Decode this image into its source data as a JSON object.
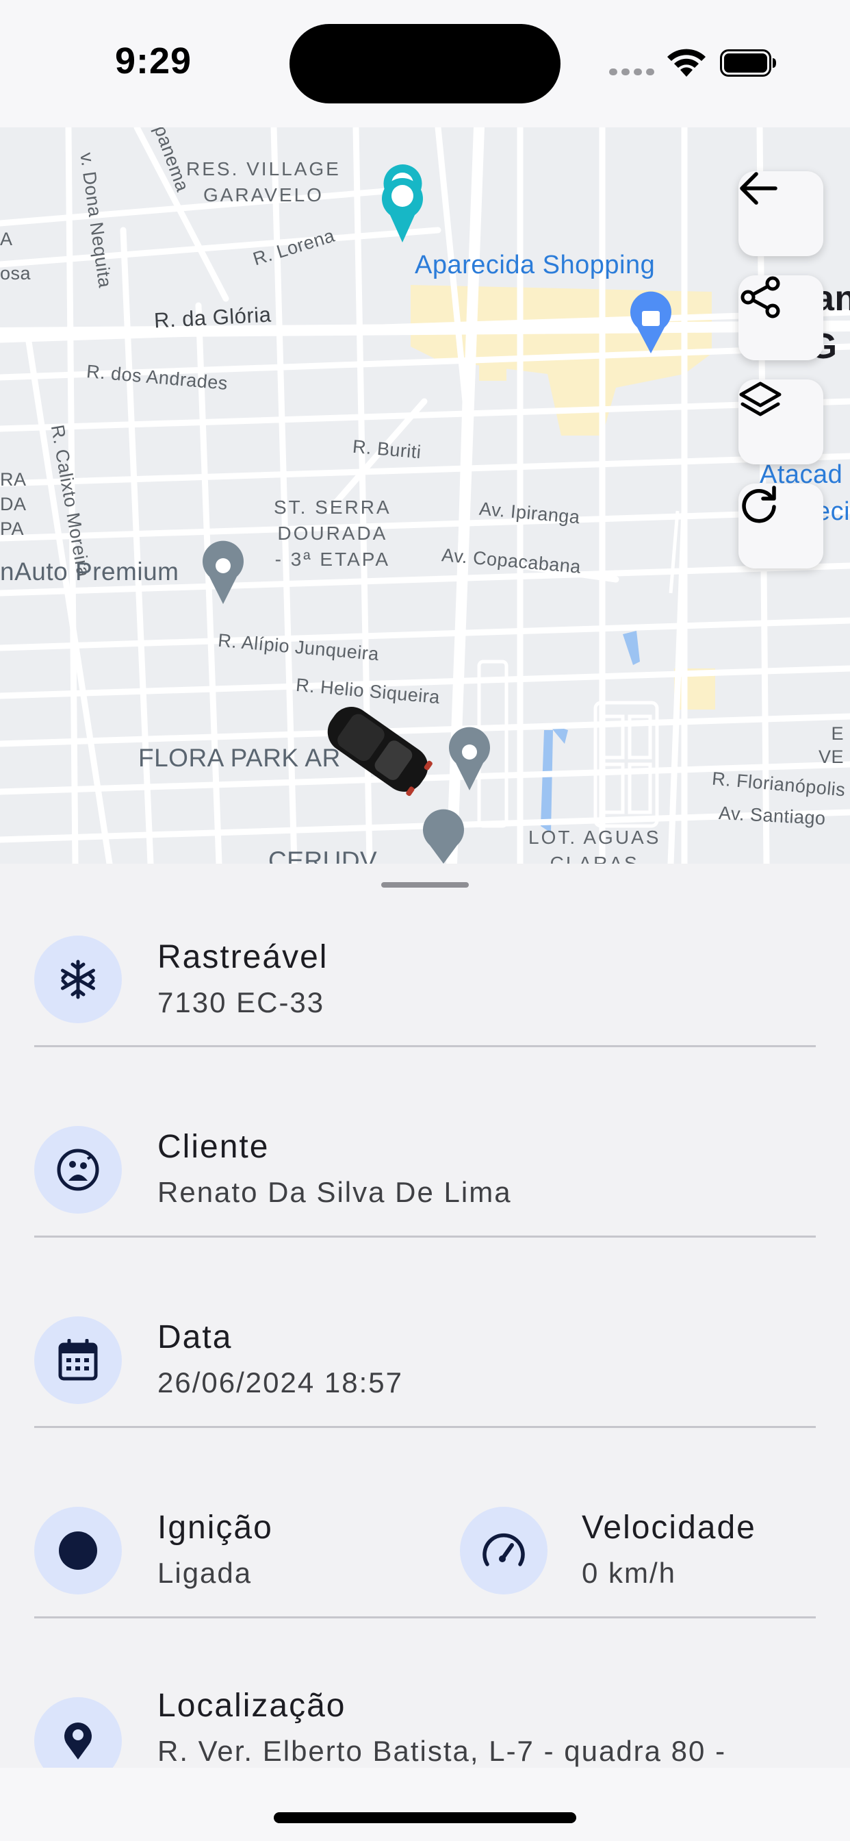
{
  "status_bar": {
    "time": "9:29"
  },
  "map": {
    "labels": {
      "res_village": "RES. VILLAGE\nGARAVELO",
      "r_lorena": "R. Lorena",
      "aparecida_shopping": "Aparecida Shopping",
      "r_gloria": "R. da Glória",
      "r_andrades": "R. dos Andrades",
      "r_calixto": "R. Calixto Moreira",
      "r_dona_nequita": "v. Dona Nequita",
      "ipanema": "panema",
      "r_buriti": "R. Buriti",
      "st_serra": "ST. SERRA\nDOURADA\n- 3ª ETAPA",
      "av_ipiranga": "Av. Ipiranga",
      "av_copacabana": "Av. Copacabana",
      "auto_premium": "nAuto Premium",
      "r_alipio": "R. Alípio Junqueira",
      "r_helio": "R. Helio Siqueira",
      "flora_park": "FLORA PARK AR",
      "r_florianopolis": "R. Florianópolis",
      "av_santiago": "Av. Santiago",
      "lot_aguas": "LOT. AGUAS\nCLARAS",
      "cerudv": "CERUDV",
      "atacad": "Atacad",
      "eci": "eci",
      "edge_an": "an",
      "edge_de_g": "de G",
      "edge_ve": "E\nVE",
      "left_ra": "RA\nDA\nPA",
      "left_a": "A\nosa"
    },
    "buttons": {
      "back": "arrow-left-icon",
      "share": "share-icon",
      "layers": "layers-icon",
      "refresh": "refresh-icon"
    }
  },
  "details": {
    "rastreavel": {
      "title": "Rastreável",
      "value": "7130 EC-33",
      "icon": "snowflake-icon"
    },
    "cliente": {
      "title": "Cliente",
      "value": "Renato Da Silva De Lima",
      "icon": "user-circle-icon"
    },
    "data": {
      "title": "Data",
      "value": "26/06/2024 18:57",
      "icon": "calendar-icon"
    },
    "ignicao": {
      "title": "Ignição",
      "value": "Ligada",
      "icon": "dot-icon"
    },
    "velocidade": {
      "title": "Velocidade",
      "value": "0 km/h",
      "icon": "speedometer-icon"
    },
    "localizacao": {
      "title": "Localização",
      "value": "R. Ver. Elberto Batista, L-7 - quadra 80 -",
      "icon": "location-icon"
    }
  },
  "colors": {
    "accent_icon_bg": "#dbe4fb",
    "icon_navy": "#0f1a3d",
    "map_poi_blue": "#2b7cd9",
    "map_pin_gray": "#7a8a96"
  }
}
